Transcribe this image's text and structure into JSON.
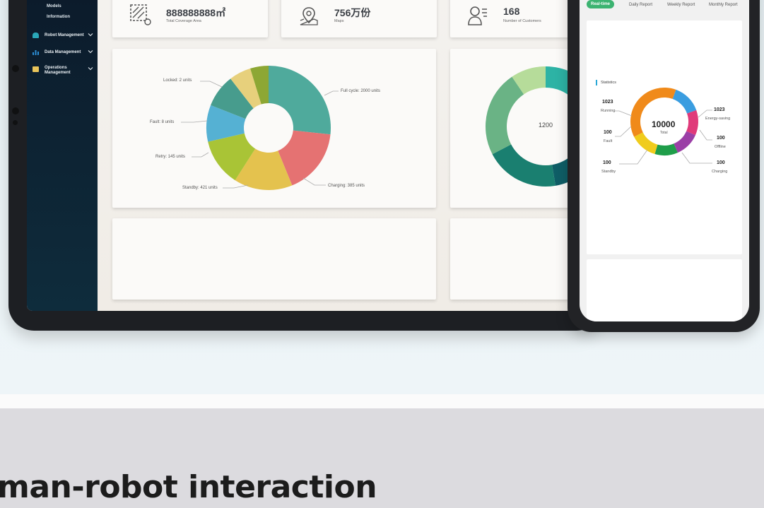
{
  "headline": "man-robot interaction",
  "sidebar": {
    "sub_items": [
      "Models",
      "Information"
    ],
    "items": [
      {
        "label": "Robot Management",
        "icon": "robot-icon",
        "color": "#2aa7b8"
      },
      {
        "label": "Data Management",
        "icon": "bar-chart-icon",
        "color": "#2b8fd6"
      },
      {
        "label": "Operations Management",
        "icon": "map-icon",
        "color": "#e8c45a"
      }
    ]
  },
  "stats": [
    {
      "value": "888888888㎡",
      "label": "Total Coverage Area",
      "icon": "area-icon"
    },
    {
      "value": "756万份",
      "label": "Maps",
      "icon": "map-pin-icon"
    },
    {
      "value": "168",
      "label": "Number of Customers",
      "icon": "customer-icon"
    }
  ],
  "chart_data": [
    {
      "type": "pie",
      "title": "",
      "labels": [
        "Full cycle: 2000 units",
        "Charging: 385 units",
        "Standby: 421 units",
        "Retry: 145 units",
        "Fault: 8 units",
        "Locked: 2 units"
      ],
      "slices": [
        {
          "name": "Full cycle",
          "value": 28,
          "color": "#4faa9c"
        },
        {
          "name": "Charging",
          "value": 18,
          "color": "#e57272"
        },
        {
          "name": "Standby",
          "value": 16,
          "color": "#e4c24e"
        },
        {
          "name": "Retry",
          "value": 13,
          "color": "#a9c436"
        },
        {
          "name": "Fault",
          "value": 10,
          "color": "#55b1d3"
        },
        {
          "name": "Locked",
          "value": 9,
          "color": "#479c8d"
        },
        {
          "name": "",
          "value": 6,
          "color": "#e7d07c"
        },
        {
          "name": "",
          "value": 5,
          "color": "#8da734"
        }
      ]
    },
    {
      "type": "pie",
      "center_label": "1200",
      "slices": [
        {
          "name": "",
          "value": 14,
          "color": "#2db3a5"
        },
        {
          "name": "",
          "value": 31,
          "color": "#0f5e66"
        },
        {
          "name": "",
          "value": 19,
          "color": "#1a7f70"
        },
        {
          "name": "",
          "value": 22,
          "color": "#6ab385"
        },
        {
          "name": "",
          "value": 9,
          "color": "#b6dc9a"
        }
      ]
    },
    {
      "type": "pie",
      "center_value": "10000",
      "center_label": "Total",
      "slices": [
        {
          "name": "Energy-saving",
          "value": 14,
          "color": "#3a9de0"
        },
        {
          "name": "Offline",
          "value": 12,
          "color": "#e03a7a"
        },
        {
          "name": "Charging",
          "value": 12,
          "color": "#9b3fa6"
        },
        {
          "name": "Standby",
          "value": 11,
          "color": "#1f9e4a"
        },
        {
          "name": "Fault",
          "value": 13,
          "color": "#f0cc1c"
        },
        {
          "name": "Running",
          "value": 38,
          "color": "#f08a1a"
        }
      ]
    }
  ],
  "phone": {
    "tabs": [
      "Real-time",
      "Daily Report",
      "Weekly Report",
      "Monthly Report"
    ],
    "section": "Statistics",
    "center_value": "10000",
    "center_label": "Total",
    "metrics": [
      {
        "value": "1023",
        "label": "Running"
      },
      {
        "value": "100",
        "label": "Fault"
      },
      {
        "value": "100",
        "label": "Standby"
      },
      {
        "value": "1023",
        "label": "Energy-saving"
      },
      {
        "value": "100",
        "label": "Offline"
      },
      {
        "value": "100",
        "label": "Charging"
      }
    ]
  }
}
